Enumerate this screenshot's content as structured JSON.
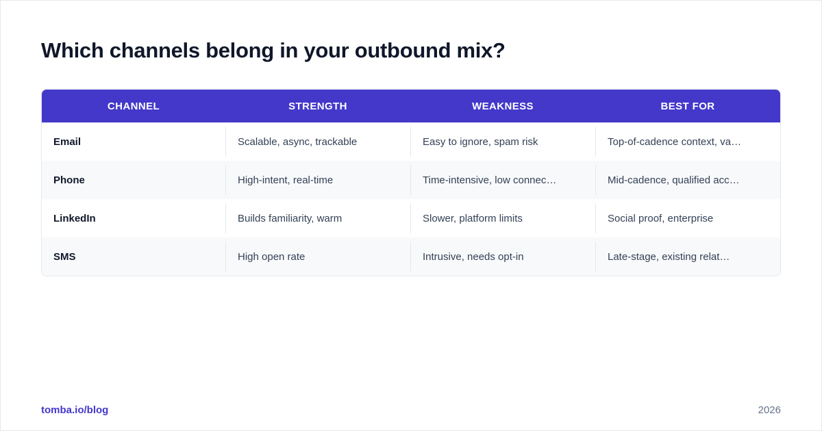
{
  "title": "Which channels belong in your outbound mix?",
  "table": {
    "headers": [
      "CHANNEL",
      "STRENGTH",
      "WEAKNESS",
      "BEST FOR"
    ],
    "rows": [
      [
        "Email",
        "Scalable, async, trackable",
        "Easy to ignore, spam risk",
        "Top-of-cadence context, va…"
      ],
      [
        "Phone",
        "High-intent, real-time",
        "Time-intensive, low connec…",
        "Mid-cadence, qualified acc…"
      ],
      [
        "LinkedIn",
        "Builds familiarity, warm",
        "Slower, platform limits",
        "Social proof, enterprise"
      ],
      [
        "SMS",
        "High open rate",
        "Intrusive, needs opt-in",
        "Late-stage, existing relat…"
      ]
    ]
  },
  "footer": {
    "link": "tomba.io/blog",
    "year": "2026"
  },
  "colors": {
    "accent": "#4338ca",
    "title": "#0f172a",
    "stripe": "#f8f9fb"
  }
}
